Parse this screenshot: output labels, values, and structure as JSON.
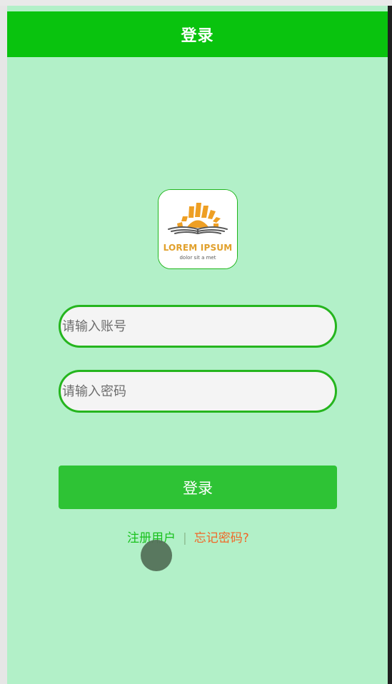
{
  "header": {
    "title": "登录"
  },
  "logo": {
    "title": "LOREM IPSUM",
    "subtitle": "dolor sit a met"
  },
  "form": {
    "account_placeholder": "请输入账号",
    "password_placeholder": "请输入密码",
    "login_label": "登录"
  },
  "links": {
    "register": "注册用户",
    "separator": "|",
    "forgot_password": "忘记密码?"
  },
  "colors": {
    "header_green": "#09c30e",
    "page_green": "#b2f0c8",
    "button_green": "#2ec335",
    "link_green": "#18c11c",
    "link_orange": "#f06728"
  },
  "icons": {
    "logo": "sun-over-book-icon",
    "touch": "touch-indicator"
  }
}
